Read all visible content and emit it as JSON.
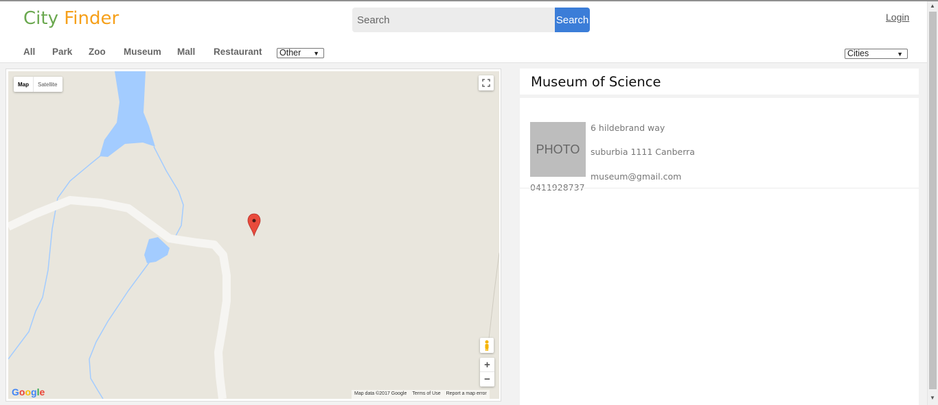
{
  "app": {
    "title_part1": "City",
    "title_part2": "Finder",
    "login": "Login"
  },
  "search": {
    "placeholder": "Search",
    "button": "Search"
  },
  "nav": {
    "items": [
      "All",
      "Park",
      "Zoo",
      "Museum",
      "Mall",
      "Restaurant"
    ],
    "other_select": "Other",
    "cities_select": "Cities"
  },
  "map": {
    "type_map": "Map",
    "type_satellite": "Satellite",
    "google": "Google",
    "map_data": "Map data ©2017 Google",
    "terms": "Terms of Use",
    "report": "Report a map error",
    "zoom_in": "+",
    "zoom_out": "−"
  },
  "place": {
    "name": "Museum of Science",
    "photo_label": "PHOTO",
    "address_line1": "6 hildebrand way",
    "address_line2": "suburbia 1111 Canberra",
    "email": "museum@gmail.com",
    "phone": "0411928737"
  },
  "colors": {
    "city": "#6aa84f",
    "finder": "#f6a01a",
    "search_button": "#3b7dd8",
    "water": "#a3ccff",
    "land": "#e9e6dd",
    "marker": "#e94b3c"
  }
}
